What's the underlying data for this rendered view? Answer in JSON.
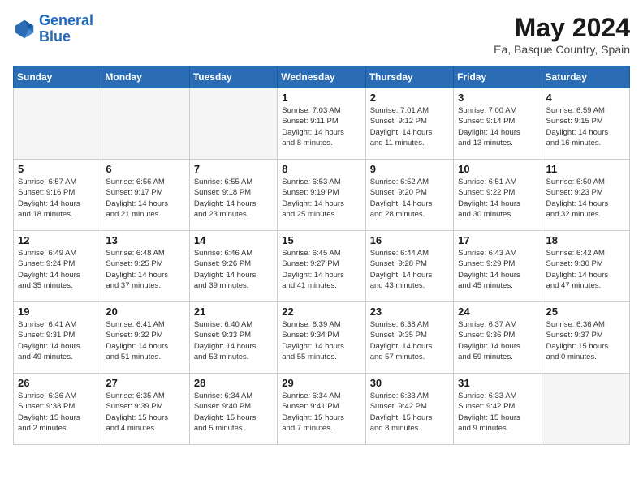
{
  "header": {
    "logo_line1": "General",
    "logo_line2": "Blue",
    "month_title": "May 2024",
    "location": "Ea, Basque Country, Spain"
  },
  "weekdays": [
    "Sunday",
    "Monday",
    "Tuesday",
    "Wednesday",
    "Thursday",
    "Friday",
    "Saturday"
  ],
  "weeks": [
    [
      {
        "day": "",
        "info": ""
      },
      {
        "day": "",
        "info": ""
      },
      {
        "day": "",
        "info": ""
      },
      {
        "day": "1",
        "info": "Sunrise: 7:03 AM\nSunset: 9:11 PM\nDaylight: 14 hours\nand 8 minutes."
      },
      {
        "day": "2",
        "info": "Sunrise: 7:01 AM\nSunset: 9:12 PM\nDaylight: 14 hours\nand 11 minutes."
      },
      {
        "day": "3",
        "info": "Sunrise: 7:00 AM\nSunset: 9:14 PM\nDaylight: 14 hours\nand 13 minutes."
      },
      {
        "day": "4",
        "info": "Sunrise: 6:59 AM\nSunset: 9:15 PM\nDaylight: 14 hours\nand 16 minutes."
      }
    ],
    [
      {
        "day": "5",
        "info": "Sunrise: 6:57 AM\nSunset: 9:16 PM\nDaylight: 14 hours\nand 18 minutes."
      },
      {
        "day": "6",
        "info": "Sunrise: 6:56 AM\nSunset: 9:17 PM\nDaylight: 14 hours\nand 21 minutes."
      },
      {
        "day": "7",
        "info": "Sunrise: 6:55 AM\nSunset: 9:18 PM\nDaylight: 14 hours\nand 23 minutes."
      },
      {
        "day": "8",
        "info": "Sunrise: 6:53 AM\nSunset: 9:19 PM\nDaylight: 14 hours\nand 25 minutes."
      },
      {
        "day": "9",
        "info": "Sunrise: 6:52 AM\nSunset: 9:20 PM\nDaylight: 14 hours\nand 28 minutes."
      },
      {
        "day": "10",
        "info": "Sunrise: 6:51 AM\nSunset: 9:22 PM\nDaylight: 14 hours\nand 30 minutes."
      },
      {
        "day": "11",
        "info": "Sunrise: 6:50 AM\nSunset: 9:23 PM\nDaylight: 14 hours\nand 32 minutes."
      }
    ],
    [
      {
        "day": "12",
        "info": "Sunrise: 6:49 AM\nSunset: 9:24 PM\nDaylight: 14 hours\nand 35 minutes."
      },
      {
        "day": "13",
        "info": "Sunrise: 6:48 AM\nSunset: 9:25 PM\nDaylight: 14 hours\nand 37 minutes."
      },
      {
        "day": "14",
        "info": "Sunrise: 6:46 AM\nSunset: 9:26 PM\nDaylight: 14 hours\nand 39 minutes."
      },
      {
        "day": "15",
        "info": "Sunrise: 6:45 AM\nSunset: 9:27 PM\nDaylight: 14 hours\nand 41 minutes."
      },
      {
        "day": "16",
        "info": "Sunrise: 6:44 AM\nSunset: 9:28 PM\nDaylight: 14 hours\nand 43 minutes."
      },
      {
        "day": "17",
        "info": "Sunrise: 6:43 AM\nSunset: 9:29 PM\nDaylight: 14 hours\nand 45 minutes."
      },
      {
        "day": "18",
        "info": "Sunrise: 6:42 AM\nSunset: 9:30 PM\nDaylight: 14 hours\nand 47 minutes."
      }
    ],
    [
      {
        "day": "19",
        "info": "Sunrise: 6:41 AM\nSunset: 9:31 PM\nDaylight: 14 hours\nand 49 minutes."
      },
      {
        "day": "20",
        "info": "Sunrise: 6:41 AM\nSunset: 9:32 PM\nDaylight: 14 hours\nand 51 minutes."
      },
      {
        "day": "21",
        "info": "Sunrise: 6:40 AM\nSunset: 9:33 PM\nDaylight: 14 hours\nand 53 minutes."
      },
      {
        "day": "22",
        "info": "Sunrise: 6:39 AM\nSunset: 9:34 PM\nDaylight: 14 hours\nand 55 minutes."
      },
      {
        "day": "23",
        "info": "Sunrise: 6:38 AM\nSunset: 9:35 PM\nDaylight: 14 hours\nand 57 minutes."
      },
      {
        "day": "24",
        "info": "Sunrise: 6:37 AM\nSunset: 9:36 PM\nDaylight: 14 hours\nand 59 minutes."
      },
      {
        "day": "25",
        "info": "Sunrise: 6:36 AM\nSunset: 9:37 PM\nDaylight: 15 hours\nand 0 minutes."
      }
    ],
    [
      {
        "day": "26",
        "info": "Sunrise: 6:36 AM\nSunset: 9:38 PM\nDaylight: 15 hours\nand 2 minutes."
      },
      {
        "day": "27",
        "info": "Sunrise: 6:35 AM\nSunset: 9:39 PM\nDaylight: 15 hours\nand 4 minutes."
      },
      {
        "day": "28",
        "info": "Sunrise: 6:34 AM\nSunset: 9:40 PM\nDaylight: 15 hours\nand 5 minutes."
      },
      {
        "day": "29",
        "info": "Sunrise: 6:34 AM\nSunset: 9:41 PM\nDaylight: 15 hours\nand 7 minutes."
      },
      {
        "day": "30",
        "info": "Sunrise: 6:33 AM\nSunset: 9:42 PM\nDaylight: 15 hours\nand 8 minutes."
      },
      {
        "day": "31",
        "info": "Sunrise: 6:33 AM\nSunset: 9:42 PM\nDaylight: 15 hours\nand 9 minutes."
      },
      {
        "day": "",
        "info": ""
      }
    ]
  ]
}
